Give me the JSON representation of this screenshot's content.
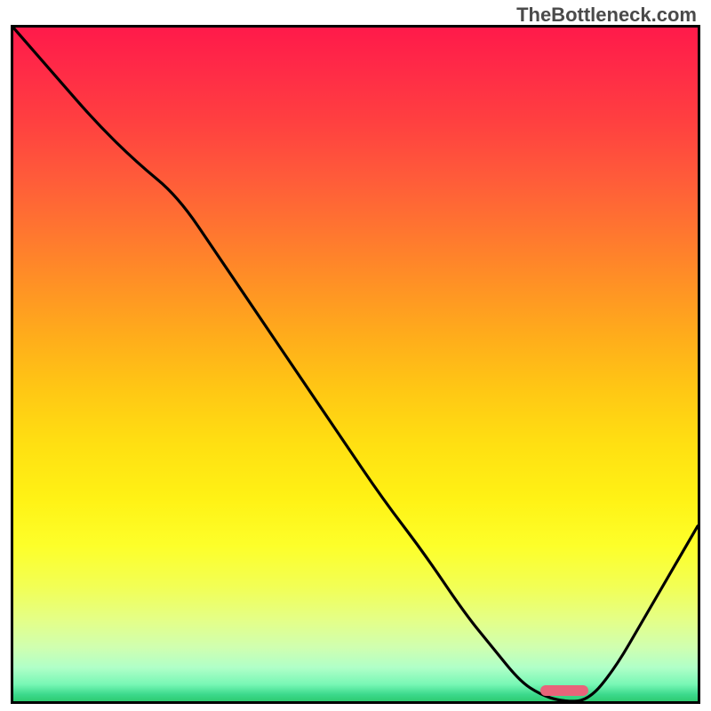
{
  "watermark": "TheBottleneck.com",
  "chart_data": {
    "type": "line",
    "title": "",
    "xlabel": "",
    "ylabel": "",
    "xlim": [
      0,
      100
    ],
    "ylim": [
      0,
      100
    ],
    "x": [
      0,
      6,
      12,
      18,
      24,
      30,
      36,
      42,
      48,
      54,
      60,
      66,
      70,
      74,
      77,
      80,
      84,
      88,
      92,
      96,
      100
    ],
    "values": [
      100,
      93,
      86,
      80,
      75,
      66,
      57,
      48,
      39,
      30,
      22,
      13,
      8,
      3,
      1,
      0,
      0,
      5,
      12,
      19,
      26
    ],
    "gradient_stops": [
      {
        "pos": 0.0,
        "color": "#ff1a4a"
      },
      {
        "pos": 0.5,
        "color": "#ffc814"
      },
      {
        "pos": 0.8,
        "color": "#fdff2a"
      },
      {
        "pos": 1.0,
        "color": "#2ecc71"
      }
    ],
    "marker": {
      "x_start": 77,
      "x_end": 84,
      "y": 0,
      "color": "#e8647a"
    }
  }
}
